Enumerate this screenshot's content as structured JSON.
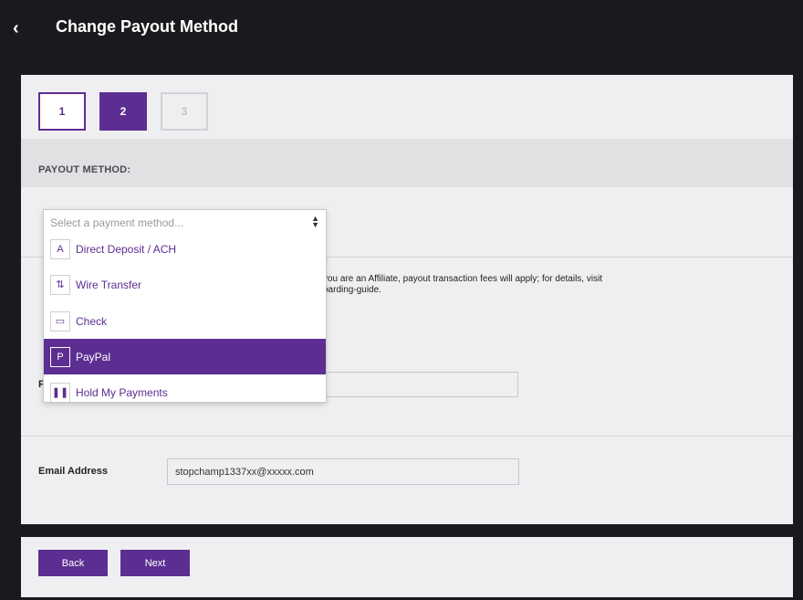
{
  "header": {
    "back_icon": "chevron-left-icon",
    "title": "Change Payout Method"
  },
  "steps": [
    "1",
    "2",
    "3"
  ],
  "payout_method": {
    "label": "PAYOUT METHOD:",
    "placeholder": "Select a payment method...",
    "options": [
      {
        "label": "Direct Deposit / ACH",
        "icon": "bank-icon",
        "glyph": "A"
      },
      {
        "label": "Wire Transfer",
        "icon": "transfer-icon",
        "glyph": "⇅"
      },
      {
        "label": "Check",
        "icon": "check-icon",
        "glyph": "▭"
      },
      {
        "label": "PayPal",
        "icon": "paypal-icon",
        "glyph": "P",
        "selected": true
      },
      {
        "label": "Hold My Payments",
        "icon": "pause-icon",
        "glyph": "❚❚"
      }
    ]
  },
  "info": {
    "line1": "you are an Affiliate, payout transaction fees will apply; for details, visit",
    "line2": "oarding-guide."
  },
  "paypal_field_label_fragment": "F",
  "email": {
    "label": "Email Address",
    "value": "stopchamp1337xx@xxxxx.com"
  },
  "buttons": {
    "back": "Back",
    "next": "Next"
  },
  "colors": {
    "accent": "#5c2e91",
    "background": "#1a191d",
    "panel": "#efeff1"
  }
}
